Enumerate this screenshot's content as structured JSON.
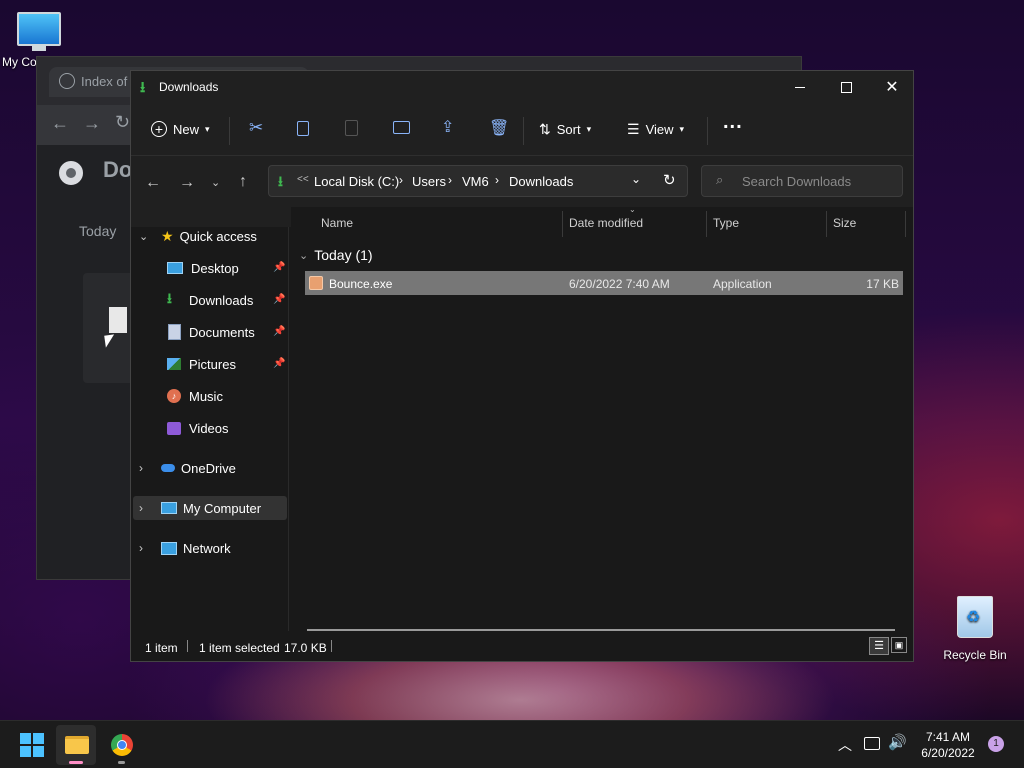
{
  "desktop": {
    "icons": [
      {
        "label": "My Co"
      },
      {
        "label": "Recycle Bin"
      }
    ]
  },
  "browser": {
    "tab_title": "Index of /",
    "heading_partial": "Do",
    "section_label": "Today"
  },
  "explorer": {
    "title": "Downloads",
    "toolbar": {
      "new_label": "New",
      "sort_label": "Sort",
      "view_label": "View",
      "more_label": "..."
    },
    "address": {
      "overflow": "<<",
      "crumbs": [
        "Local Disk (C:)",
        "Users",
        "VM6",
        "Downloads"
      ]
    },
    "search": {
      "placeholder": "Search Downloads"
    },
    "nav": {
      "quick_access": "Quick access",
      "items": [
        {
          "label": "Desktop",
          "icon": "desktop-icon",
          "pinned": true
        },
        {
          "label": "Downloads",
          "icon": "downloads-icon",
          "pinned": true
        },
        {
          "label": "Documents",
          "icon": "documents-icon",
          "pinned": true
        },
        {
          "label": "Pictures",
          "icon": "pictures-icon",
          "pinned": true
        },
        {
          "label": "Music",
          "icon": "music-icon",
          "pinned": false
        },
        {
          "label": "Videos",
          "icon": "videos-icon",
          "pinned": false
        }
      ],
      "onedrive": "OneDrive",
      "my_computer": "My Computer",
      "network": "Network"
    },
    "columns": {
      "name": "Name",
      "date": "Date modified",
      "type": "Type",
      "size": "Size"
    },
    "group": {
      "label": "Today (1)"
    },
    "files": [
      {
        "name": "Bounce.exe",
        "date": "6/20/2022 7:40 AM",
        "type": "Application",
        "size": "17 KB",
        "selected": true
      }
    ],
    "status": {
      "count": "1 item",
      "selected": "1 item selected",
      "size": "17.0 KB"
    }
  },
  "taskbar": {
    "time": "7:41 AM",
    "date": "6/20/2022",
    "notification_count": "1"
  },
  "colors": {
    "accent_blue": "#0078d4",
    "selection": "#777777",
    "download_green": "#3fb950"
  }
}
